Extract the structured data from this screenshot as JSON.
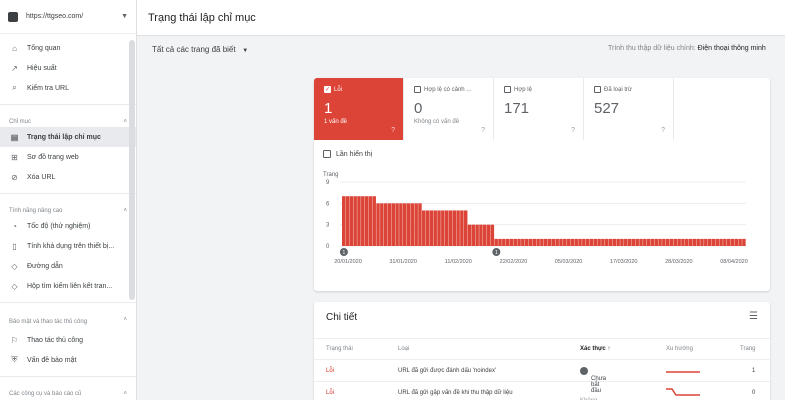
{
  "sidebar": {
    "property_url": "https://ttgseo.com/",
    "items_top": [
      {
        "label": "Tổng quan",
        "icon": "home-icon",
        "glyph": "⌂"
      },
      {
        "label": "Hiệu suất",
        "icon": "trend-icon",
        "glyph": "↗"
      },
      {
        "label": "Kiểm tra URL",
        "icon": "search-icon",
        "glyph": "⌕"
      }
    ],
    "section_index": "Chỉ mục",
    "items_index": [
      {
        "label": "Trạng thái lập chỉ mục",
        "icon": "document-icon",
        "glyph": "▤",
        "active": true
      },
      {
        "label": "Sơ đồ trang web",
        "icon": "sitemap-icon",
        "glyph": "⊞"
      },
      {
        "label": "Xóa URL",
        "icon": "remove-icon",
        "glyph": "⊘"
      }
    ],
    "section_enhance": "Tính năng nâng cao",
    "items_enhance": [
      {
        "label": "Tốc độ (thử nghiệm)",
        "icon": "speed-icon",
        "glyph": "◔"
      },
      {
        "label": "Tính khả dụng trên thiết bị...",
        "icon": "mobile-icon",
        "glyph": "▯"
      },
      {
        "label": "Đường dẫn",
        "icon": "breadcrumb-icon",
        "glyph": "◇"
      },
      {
        "label": "Hộp tìm kiếm liên kết tran...",
        "icon": "sitelinks-icon",
        "glyph": "◇"
      }
    ],
    "section_security": "Bảo mật và thao tác thủ công",
    "items_security": [
      {
        "label": "Thao tác thủ công",
        "icon": "flag-icon",
        "glyph": "⚐"
      },
      {
        "label": "Vấn đề bảo mật",
        "icon": "shield-icon",
        "glyph": "⛨"
      }
    ],
    "section_legacy": "Các công cụ và báo cáo cũ"
  },
  "header": {
    "title": "Trạng thái lập chỉ mục"
  },
  "filter": {
    "label": "Tất cả các trang đã biết",
    "caret": "▼"
  },
  "crawler": {
    "label": "Trình thu thập dữ liệu chính:",
    "value": "Điện thoại thông minh"
  },
  "tiles": [
    {
      "label": "Lỗi",
      "value": "1",
      "sub": "1 vấn đề",
      "checked": true
    },
    {
      "label": "Hợp lệ có cảnh ...",
      "value": "0",
      "sub": "Không có vấn đề",
      "checked": false
    },
    {
      "label": "Hợp lệ",
      "value": "171",
      "sub": "",
      "checked": false
    },
    {
      "label": "Đã loại trừ",
      "value": "527",
      "sub": "",
      "checked": false
    }
  ],
  "impressions_label": "Lần hiển thị",
  "colors": {
    "error": "#db4437",
    "accent": "#1a73e8"
  },
  "chart_data": {
    "type": "bar",
    "ylabel": "Trang",
    "yticks": [
      0,
      3,
      6,
      9
    ],
    "ylim": [
      0,
      9
    ],
    "xticks": [
      "20/01/2020",
      "31/01/2020",
      "11/02/2020",
      "22/02/2020",
      "05/03/2020",
      "17/03/2020",
      "28/03/2020",
      "08/04/2020"
    ],
    "values": [
      7,
      7,
      7,
      7,
      7,
      7,
      7,
      7,
      7,
      6,
      6,
      6,
      6,
      6,
      6,
      6,
      6,
      6,
      6,
      6,
      6,
      5,
      5,
      5,
      5,
      5,
      5,
      5,
      5,
      5,
      5,
      5,
      5,
      3,
      3,
      3,
      3,
      3,
      3,
      3,
      1,
      1,
      1,
      1,
      1,
      1,
      1,
      1,
      1,
      1,
      1,
      1,
      1,
      1,
      1,
      1,
      1,
      1,
      1,
      1,
      1,
      1,
      1,
      1,
      1,
      1,
      1,
      1,
      1,
      1,
      1,
      1,
      1,
      1,
      1,
      1,
      1,
      1,
      1,
      1,
      1,
      1,
      1,
      1,
      1,
      1,
      1,
      1,
      1,
      1,
      1,
      1,
      1,
      1,
      1,
      1,
      1,
      1,
      1,
      1,
      1,
      1,
      1,
      1,
      1,
      1
    ],
    "annotations": [
      {
        "label": "1",
        "index": 0
      },
      {
        "label": "1",
        "index": 40
      }
    ],
    "grid": true,
    "color": "#db4437"
  },
  "details": {
    "title": "Chi tiết",
    "columns": {
      "status": "Trạng thái",
      "type": "Loại",
      "validation": "Xác thực ↑",
      "trend": "Xu hướng",
      "pages": "Trang"
    },
    "rows": [
      {
        "status": "Lỗi",
        "type": "URL đã gửi được đánh dấu 'noindex'",
        "validation": "Chưa bắt đầu",
        "pages": "1"
      },
      {
        "status": "Lỗi",
        "type": "URL đã gửi gặp vấn đề khi thu thập dữ liệu",
        "validation": "Không có",
        "pages": "0"
      }
    ]
  }
}
